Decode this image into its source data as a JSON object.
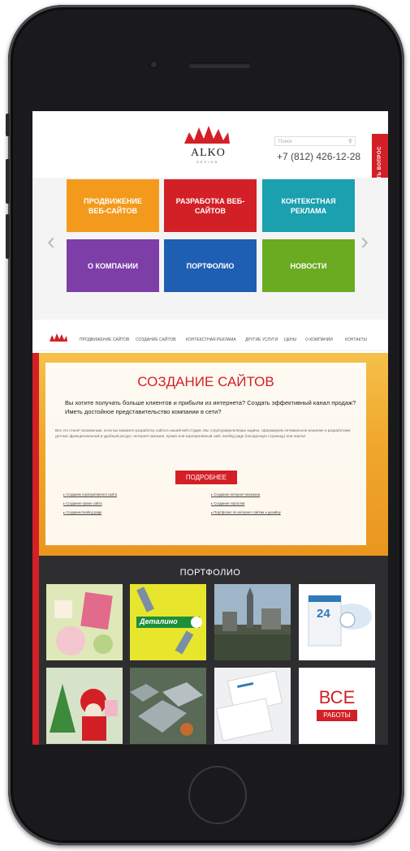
{
  "header": {
    "logo_text": "ALKO",
    "logo_sub": "DESIGN",
    "search_placeholder": "Поиск",
    "phone": "+7 (812) 426-12-28"
  },
  "ask_tab_label": "ЗАДАТЬ ВОПРОС",
  "tiles": [
    {
      "label": "ПРОДВИЖЕНИЕ ВЕБ-САЙТОВ",
      "color": "#f39a1c"
    },
    {
      "label": "РАЗРАБОТКА ВЕБ-САЙТОВ",
      "color": "#d32027"
    },
    {
      "label": "КОНТЕКСТНАЯ РЕКЛАМА",
      "color": "#1aa0ae"
    },
    {
      "label": "О КОМПАНИИ",
      "color": "#7d3ea8"
    },
    {
      "label": "ПОРТФОЛИО",
      "color": "#1f5fb3"
    },
    {
      "label": "НОВОСТИ",
      "color": "#6aab22"
    }
  ],
  "nav": {
    "items": [
      "ПРОДВИЖЕНИЕ САЙТОВ",
      "СОЗДАНИЕ САЙТОВ",
      "КОНТЕКСТНАЯ РЕКЛАМА",
      "ДРУГИЕ УСЛУГИ",
      "ЦЕНЫ",
      "О КОМПАНИИ",
      "КОНТАКТЫ"
    ]
  },
  "hero": {
    "title": "СОЗДАНИЕ САЙТОВ",
    "lead": "Вы хотите получать больше клиентов и прибыли из интернета? Создать эффективный канал продаж? Иметь достойное представительство компании в сети?",
    "body": "Все это станет возможным, если вы закажете разработку сайта в нашей веб-студии. Мы структурируем Ваши задачи, сформируем оптимальное решение и разработаем для вас функциональный и удобный ресурс: интернет-магазин, промо или корпоративный сайт, landing page (посадочную страницу) или портал.",
    "button": "ПОДРОБНЕЕ",
    "links_left": [
      "Создание корпоративного сайта",
      "Создание промо сайта",
      "Создание landing page"
    ],
    "links_right": [
      "Создание интернет-магазина",
      "Создание порталов",
      "Портфолио по интернет-сайтам и дизайну"
    ]
  },
  "portfolio": {
    "title": "ПОРТФОЛИО",
    "thumb_texts": {
      "detalino": "Деталино",
      "box_number": "24",
      "all_top": "ВСЕ",
      "all_bottom": "РАБОТЫ"
    }
  }
}
